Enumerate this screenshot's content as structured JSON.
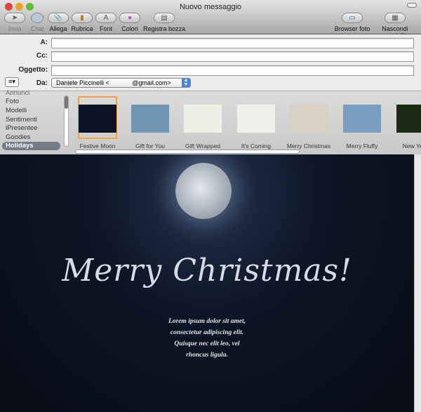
{
  "window": {
    "title": "Nuovo messaggio"
  },
  "toolbar": {
    "left": [
      {
        "label": "Invia",
        "icon": "send-icon",
        "glyph": "➤",
        "enabled": false
      },
      {
        "label": "Chat",
        "icon": "chat-icon",
        "glyph": "",
        "enabled": false
      },
      {
        "label": "Allega",
        "icon": "paperclip-icon",
        "glyph": "📎",
        "enabled": true
      },
      {
        "label": "Rubrica",
        "icon": "address-book-icon",
        "glyph": "▮",
        "enabled": true
      },
      {
        "label": "Font",
        "icon": "font-icon",
        "glyph": "A",
        "enabled": true
      },
      {
        "label": "Colori",
        "icon": "color-wheel-icon",
        "glyph": "●",
        "enabled": true
      },
      {
        "label": "Registra bozza",
        "icon": "draft-icon",
        "glyph": "▤",
        "enabled": true
      }
    ],
    "right": [
      {
        "label": "Browser foto",
        "icon": "photo-browser-icon",
        "glyph": "▭"
      },
      {
        "label": "Nascondi modelli",
        "icon": "stationery-icon",
        "glyph": "▦"
      }
    ]
  },
  "fields": {
    "to_label": "A:",
    "to": "",
    "cc_label": "Cc:",
    "cc": "",
    "subject_label": "Oggetto:",
    "subject": "",
    "from_label": "Da:",
    "from": "Daniele Piccinelli <             @gmail.com>"
  },
  "stationery": {
    "categories": [
      "Annunci",
      "Foto",
      "Modelli",
      "Sentimenti",
      "iPresentee",
      "Goodies",
      "Holidays"
    ],
    "selected_category": "Holidays",
    "templates": [
      {
        "name": "Festive Moon",
        "color": "#0b1224"
      },
      {
        "name": "Gift for You",
        "color": "#6f97b3"
      },
      {
        "name": "Gift Wrapped",
        "color": "#eef0e6"
      },
      {
        "name": "It's Coming",
        "color": "#f1f1ec"
      },
      {
        "name": "Merry Christmas",
        "color": "#d8d2c2"
      },
      {
        "name": "Merry Fluffy",
        "color": "#7b9fc0"
      },
      {
        "name": "New Year",
        "color": "#1b2a12"
      }
    ],
    "selected_template": "Festive Moon"
  },
  "message": {
    "heading": "Merry Christmas!",
    "lines": [
      "Lorem ipsum dolor sit amet,",
      "consectetur adipiscing elit.",
      "Quisque nec elit leo, vel",
      "rhoncus ligula."
    ]
  }
}
